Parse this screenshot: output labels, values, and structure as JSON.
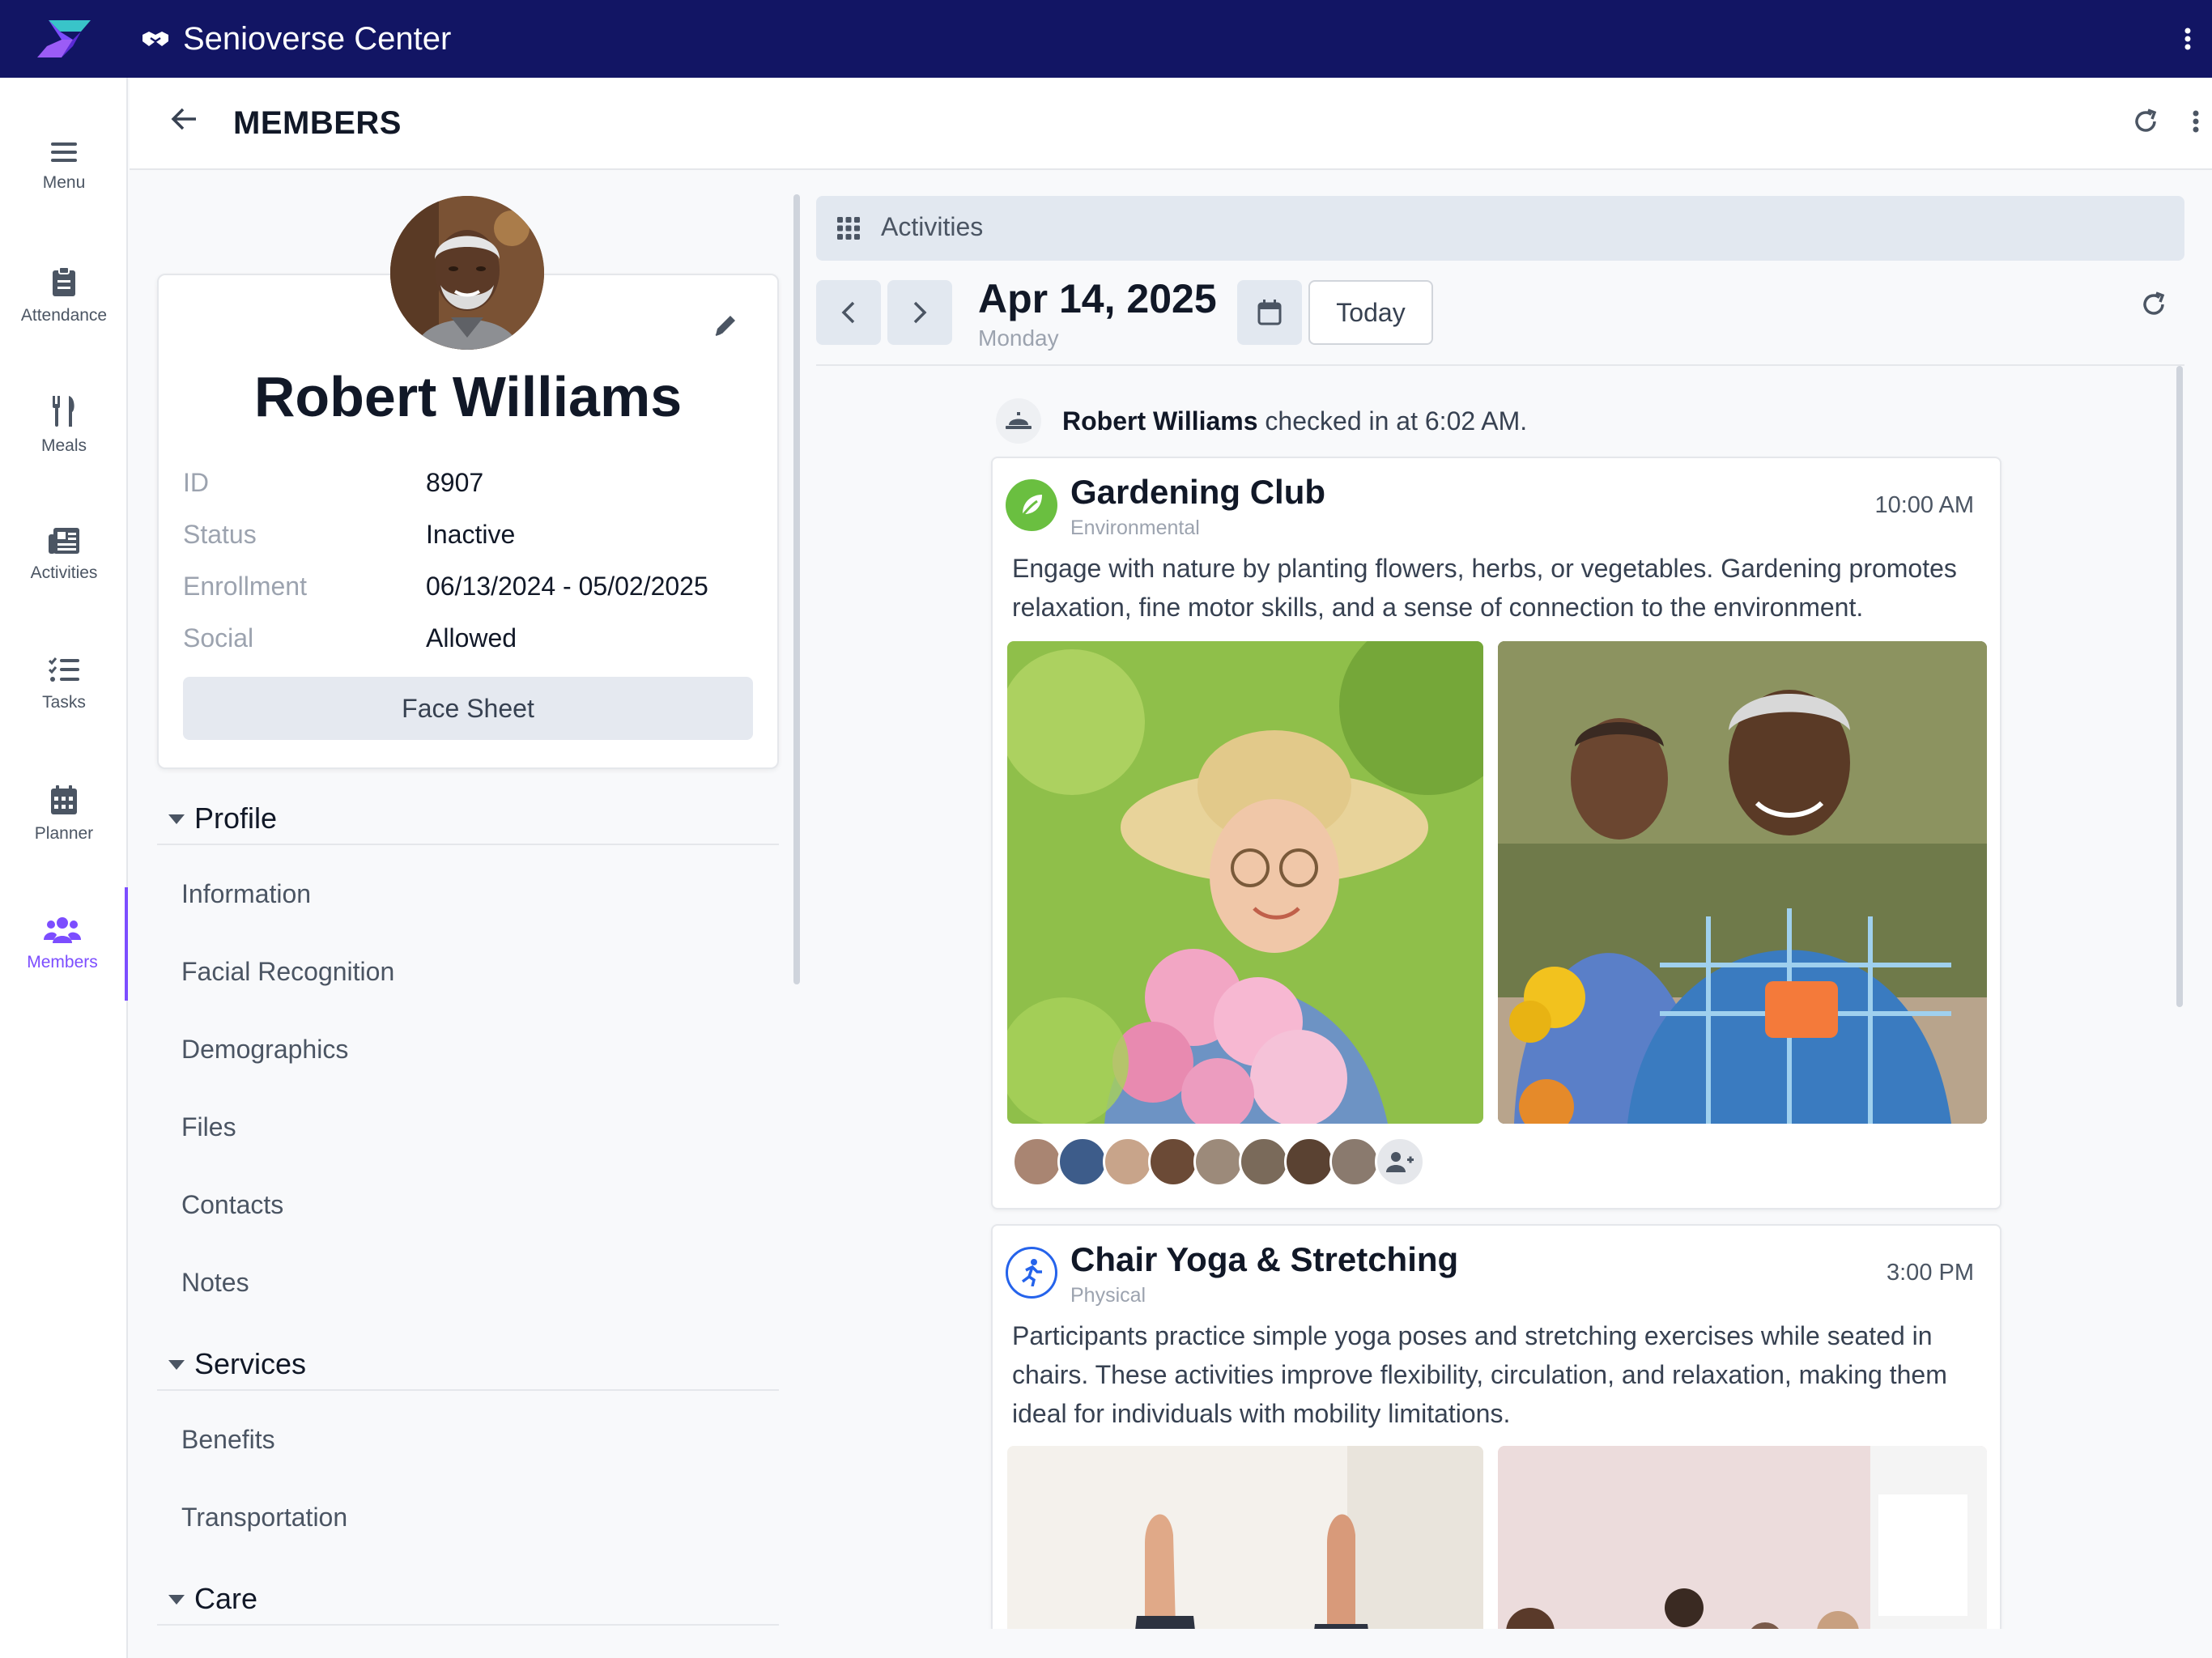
{
  "app": {
    "title": "Senioverse Center"
  },
  "rail": {
    "items": [
      {
        "label": "Menu"
      },
      {
        "label": "Attendance"
      },
      {
        "label": "Meals"
      },
      {
        "label": "Activities"
      },
      {
        "label": "Tasks"
      },
      {
        "label": "Planner"
      },
      {
        "label": "Members"
      }
    ],
    "active": "Members",
    "active_color": "#7c4dff"
  },
  "header": {
    "title": "MEMBERS"
  },
  "member": {
    "name": "Robert Williams",
    "fields": [
      {
        "key": "ID",
        "value": "8907"
      },
      {
        "key": "Status",
        "value": "Inactive"
      },
      {
        "key": "Enrollment",
        "value": "06/13/2024 - 05/02/2025"
      },
      {
        "key": "Social",
        "value": "Allowed"
      }
    ],
    "face_sheet_label": "Face Sheet"
  },
  "sections": [
    {
      "title": "Profile",
      "items": [
        "Information",
        "Facial Recognition",
        "Demographics",
        "Files",
        "Contacts",
        "Notes"
      ]
    },
    {
      "title": "Services",
      "items": [
        "Benefits",
        "Transportation"
      ]
    },
    {
      "title": "Care",
      "items": []
    }
  ],
  "activities": {
    "header": "Activities",
    "date": "Apr 14, 2025",
    "weekday": "Monday",
    "today_label": "Today",
    "checkin": {
      "name": "Robert Williams",
      "text": "checked in at 6:02 AM."
    },
    "cards": [
      {
        "title": "Gardening Club",
        "category": "Environmental",
        "time": "10:00 AM",
        "description": "Engage with nature by planting flowers, herbs, or vegetables. Gardening promotes relaxation, fine motor skills, and a sense of connection to the environment.",
        "icon": "leaf-icon",
        "icon_color": "#6abf40",
        "attendee_count": 8
      },
      {
        "title": "Chair Yoga & Stretching",
        "category": "Physical",
        "time": "3:00 PM",
        "description": "Participants practice simple yoga poses and stretching exercises while seated in chairs. These activities improve flexibility, circulation, and relaxation, making them ideal for individuals with mobility limitations.",
        "icon": "running-icon",
        "icon_color": "#2563eb"
      }
    ]
  },
  "colors": {
    "topbar": "#121564",
    "accent": "#7c4dff"
  }
}
